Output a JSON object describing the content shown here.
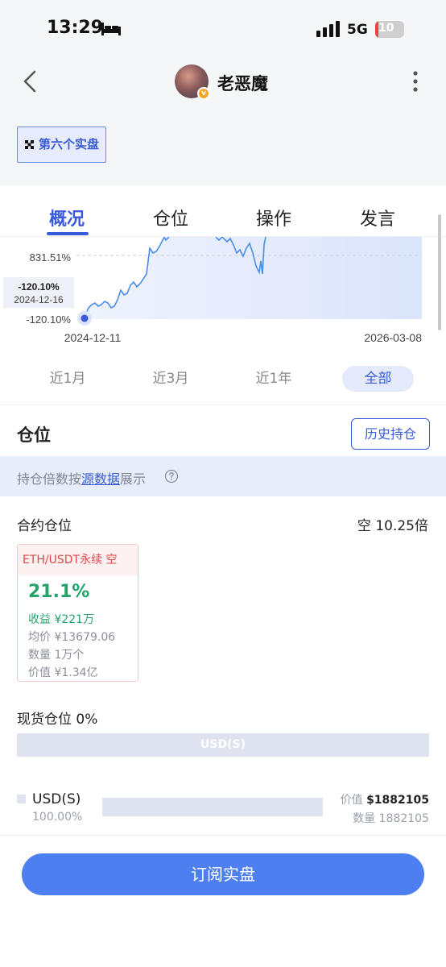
{
  "status": {
    "time": "13:29",
    "network": "5G",
    "battery": "10",
    "battery_level": 0.1
  },
  "header": {
    "username": "老恶魔",
    "tag": "第六个实盘"
  },
  "tabs": [
    "概况",
    "仓位",
    "操作",
    "发言"
  ],
  "chart_data": {
    "type": "line",
    "y_tick_labels": [
      "831.51%",
      "-120.10%"
    ],
    "x_tick_labels": [
      "2024-12-11",
      "2026-03-08"
    ],
    "tooltip": {
      "value": "-120.10%",
      "date": "2024-12-16"
    },
    "start_point": {
      "date": "2024-12-16",
      "value": -120.1
    }
  },
  "ranges": [
    "近1月",
    "近3月",
    "近1年",
    "全部"
  ],
  "positions": {
    "title": "仓位",
    "history_button": "历史持仓",
    "notice_prefix": "持仓倍数按",
    "notice_link": "源数据",
    "notice_suffix": "展示",
    "contract_label": "合约仓位",
    "contract_value": "空 10.25倍",
    "card": {
      "head": "ETH/USDT永续 空",
      "pct": "21.1%",
      "profit": "收益 ¥221万",
      "avg_price": "均价 ¥13679.06",
      "qty": "数量 1万个",
      "value": "价值 ¥1.34亿"
    },
    "spot_label": "现货仓位 0%",
    "spot_bar_label": "USD(S)",
    "asset": {
      "name": "USD(S)",
      "pct": "100.00%",
      "value_label": "价值",
      "value": "$1882105",
      "qty": "数量 1882105"
    }
  },
  "footer": {
    "subscribe": "订阅实盘"
  }
}
